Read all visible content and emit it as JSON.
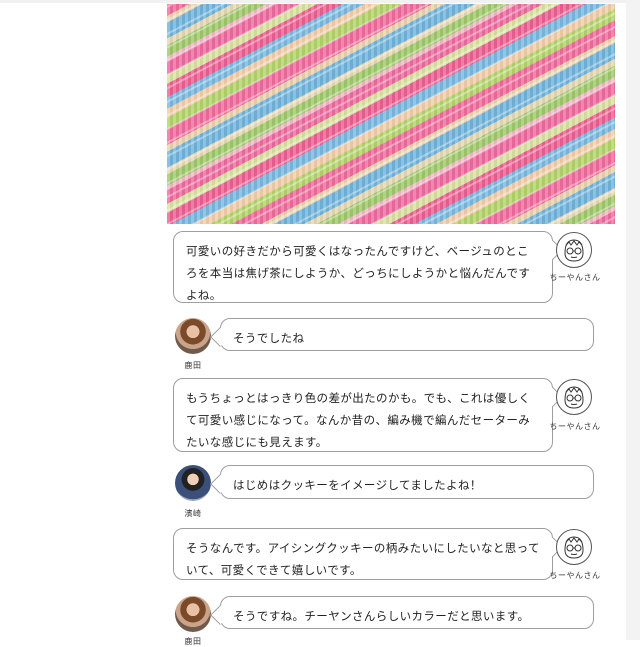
{
  "messages": [
    {
      "speaker": "ちーやんさん",
      "side": "right",
      "text": "可愛いの好きだから可愛くはなったんですけど、ベージュのところを本当は焦げ茶にしようか、どっちにしようかと悩んだんですよね。"
    },
    {
      "speaker": "鹿田",
      "side": "left",
      "text": "そうでしたね"
    },
    {
      "speaker": "ちーやんさん",
      "side": "right",
      "text": "もうちょっとはっきり色の差が出たのかも。でも、これは優しくて可愛い感じになって。なんか昔の、編み機で編んだセーターみたいな感じにも見えます。"
    },
    {
      "speaker": "濱崎",
      "side": "left",
      "text": "はじめはクッキーをイメージしてましたよね！"
    },
    {
      "speaker": "ちーやんさん",
      "side": "right",
      "text": "そうなんです。アイシングクッキーの柄みたいにしたいなと思っていて、可愛くできて嬉しいです。"
    },
    {
      "speaker": "鹿田",
      "side": "left",
      "text": "そうですね。チーヤンさんらしいカラーだと思います。"
    }
  ],
  "icons": {
    "illustration_avatar": "face-with-glasses-icon"
  },
  "colors": {
    "bubble_border": "#9e9e9e",
    "background": "#ffffff"
  }
}
